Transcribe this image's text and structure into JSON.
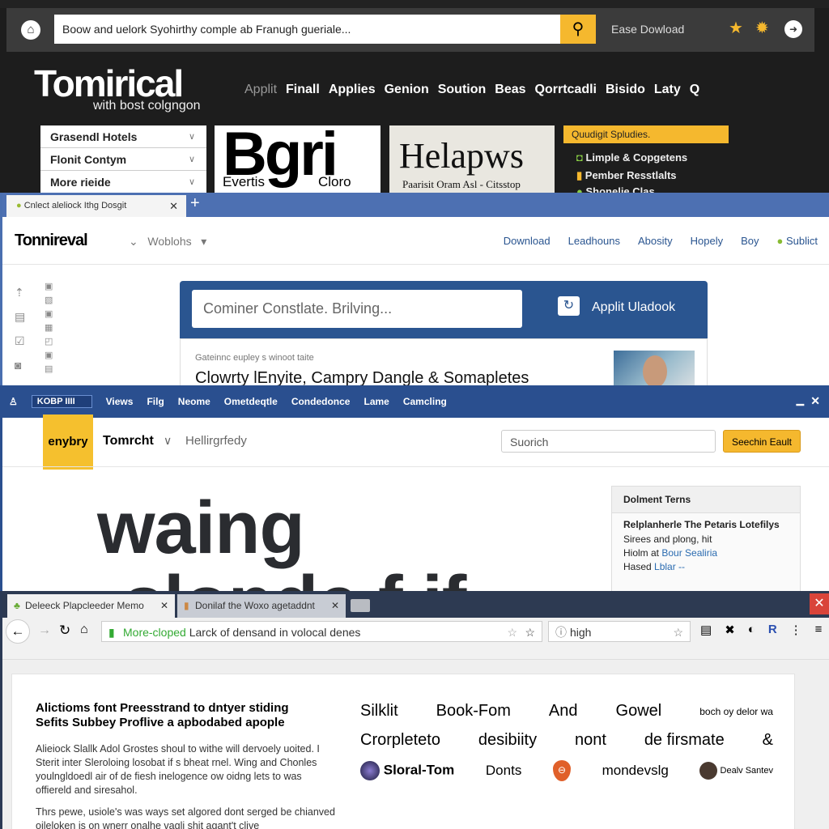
{
  "w1": {
    "search_value": "Boow and uelork Syohirthy comple ab Franugh gueriale...",
    "download": "Ease Dowload",
    "logo": "Tomirical",
    "tagline": "with bost colgngon",
    "nav": [
      "Applit",
      "Finall",
      "Applies",
      "Genion",
      "Soution",
      "Beas",
      "Qorrtcadli",
      "Bisido",
      "Laty",
      "Q"
    ],
    "dropdowns": [
      "Grasendl Hotels",
      "Flonit Contym",
      "More rieide"
    ],
    "card1": {
      "big": "Bgri",
      "left": "Evertis",
      "right": "Cloro"
    },
    "card2": {
      "big": "Helapws",
      "sub": "Paarisit Oram Asl - Citsstop"
    },
    "promo": "Quudigit Spludies.",
    "list": [
      "Limple & Copgetens",
      "Pember Resstlalts",
      "Shonelie Clas"
    ],
    "colors": {
      "accent": "#f5b82e"
    }
  },
  "w2": {
    "tab": "Cnlect aleliock Ithg Dosgit",
    "logo": "Tonnireval",
    "menu": "Woblohs",
    "nav": [
      "Download",
      "Leadhouns",
      "Abosity",
      "Hopely",
      "Boy",
      "Sublict"
    ],
    "search_placeholder": "Cominer Constlate. Brilving...",
    "apply": "Applit Uladook",
    "caption": "Gateinnc eupley s winoot taite",
    "headline": "Clowrty lEnyite, Campry Dangle & Somapletes",
    "colors": {
      "panel": "#2a5590"
    }
  },
  "w3": {
    "menu": [
      "KOBP IIII",
      "Views",
      "Filg",
      "Neome",
      "Ometdeqtle",
      "Condedonce",
      "Lame",
      "Camcling"
    ],
    "brand": "enybry",
    "site": "Tomrcht",
    "section": "Hellirgrfedy",
    "search_placeholder": "Suorich",
    "search_button": "Seechin Eault",
    "hero": [
      "waing",
      "slonde f if"
    ],
    "side": {
      "title": "Dolment Terns",
      "heading": "Relplanherle The Petaris Lotefilys",
      "l1": "Sirees and plong, hit",
      "l2a": "Hiolm at",
      "l2b": "Bour Sealiria",
      "l3a": "Hased",
      "l3b": "Lblar --"
    }
  },
  "w4": {
    "tabs": [
      "Deleeck Plapcleeder Memo",
      "Donilaf the Woxo agetaddnt"
    ],
    "url_green": "More-cloped",
    "url_rest": "Larck of densand in volocal denes",
    "search_value": "high",
    "title": "Alictioms font Preesstrand to dntyer stiding Sefits Subbey Proflive a apbodabed apople",
    "para1": "Alieiock Slallk Adol Grostes shoul to withe will dervoely uoited. I Sterit inter Sleroloing losobat if s bheat rnel. Wing and Chonles youlngldoedl air of de fiesh inelogence ow oidng lets to was offiereld and siresahol.",
    "para2": "Thrs pewe, usiole's was ways set algored dont serged be chianved oileloken is on wnerr onalhe vagli shit agant't clive",
    "row1": [
      "Silklit",
      "Book-Fom",
      "And",
      "Gowel",
      "boch oy delor wa"
    ],
    "row2": [
      "Crorpleteto",
      "desibiity",
      "nont",
      "de firsmate",
      "&"
    ],
    "row3": [
      "Sloral-Tom",
      "Donts",
      "mondevslg",
      "Dealv Santev"
    ]
  }
}
